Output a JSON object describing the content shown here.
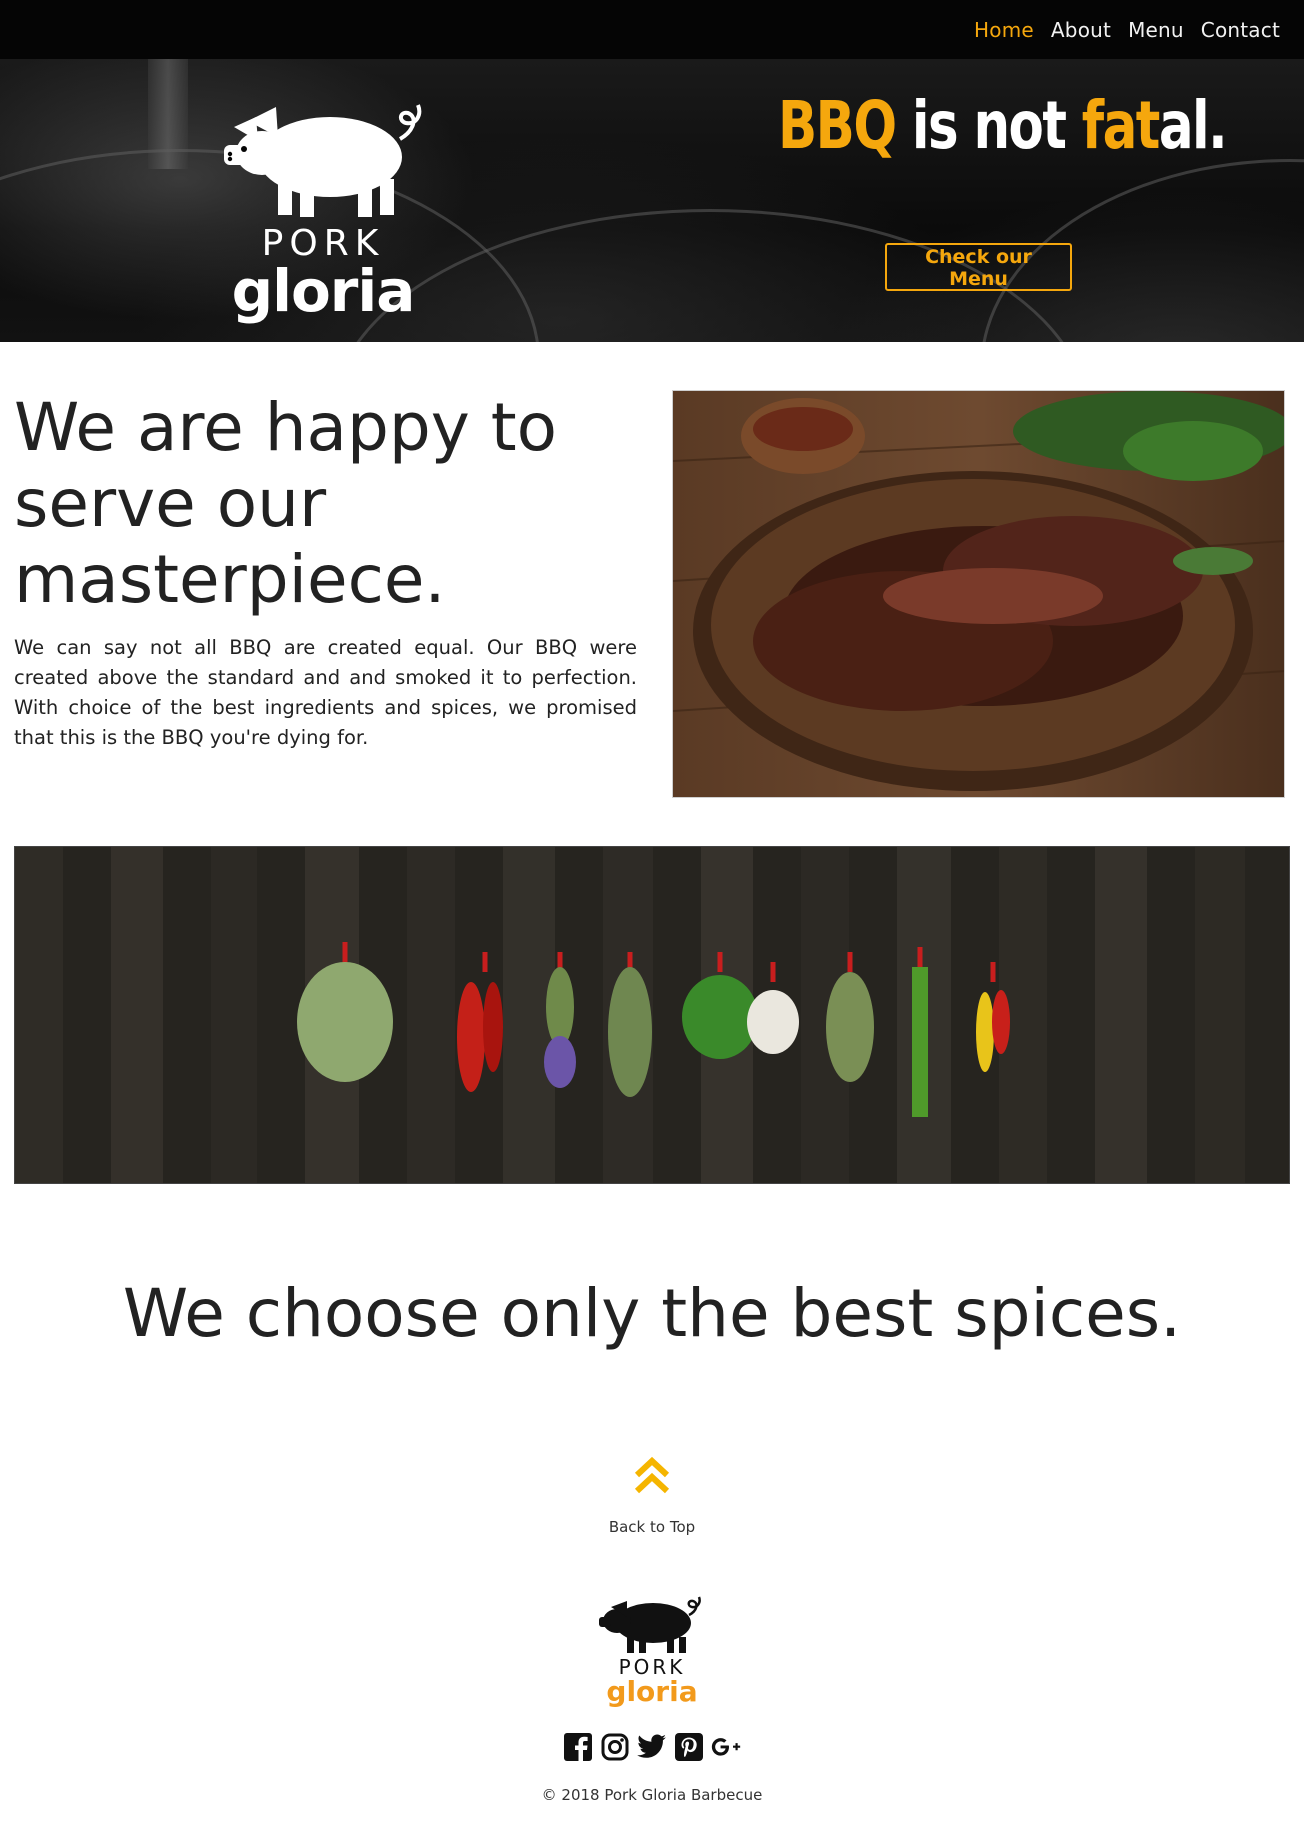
{
  "nav": {
    "items": [
      {
        "label": "Home",
        "active": true
      },
      {
        "label": "About",
        "active": false
      },
      {
        "label": "Menu",
        "active": false
      },
      {
        "label": "Contact",
        "active": false
      }
    ]
  },
  "brand": {
    "line1": "PORK",
    "line2": "gloria",
    "accent_color": "#f5a70d",
    "dark_color": "#050505"
  },
  "hero": {
    "headline": {
      "part1": "BBQ",
      "part2": " is not ",
      "part3": "fat",
      "part4": "al."
    },
    "cta_label": "Check our Menu"
  },
  "intro": {
    "title": "We are happy to serve our masterpiece.",
    "body": "We can say not all BBQ are created equal. Our BBQ were created above the standard and and smoked it to perfection. With choice of the best ingredients and spices, we promised that this is the BBQ you're dying for."
  },
  "spices": {
    "title": "We choose only the best spices."
  },
  "back_to_top": {
    "label": "Back to Top",
    "icon": "double-chevron-up-icon"
  },
  "footer": {
    "socials": [
      "facebook-icon",
      "instagram-icon",
      "twitter-icon",
      "pinterest-icon",
      "google-plus-icon"
    ],
    "copyright": "© 2018 Pork Gloria Barbecue"
  }
}
